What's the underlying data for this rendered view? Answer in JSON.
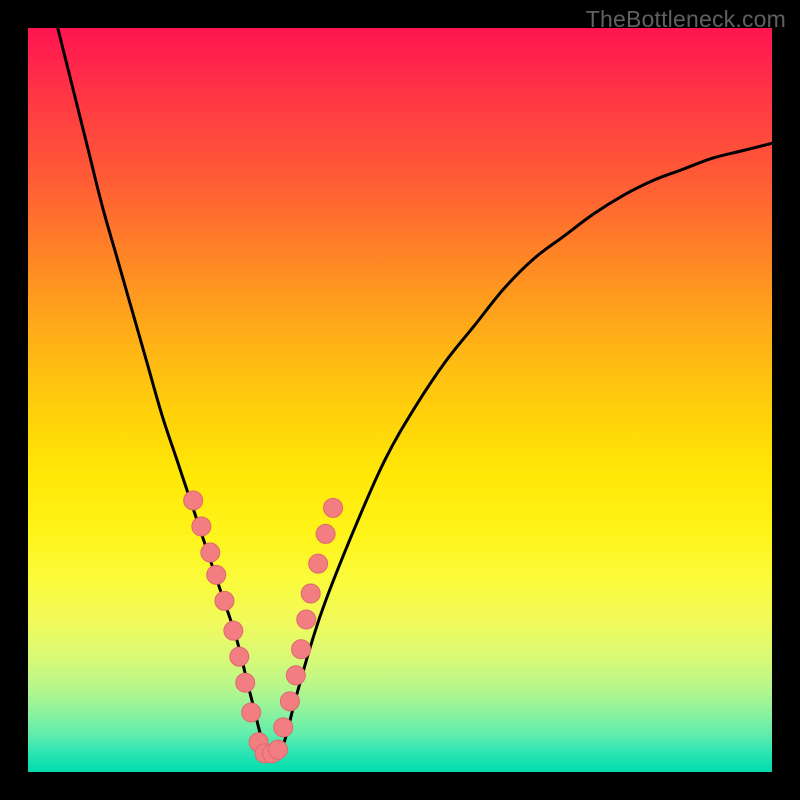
{
  "watermark": "TheBottleneck.com",
  "colors": {
    "curve": "#000000",
    "marker_fill": "#f27e82",
    "marker_stroke": "#de696d",
    "background_frame": "#000000"
  },
  "chart_data": {
    "type": "line",
    "title": "",
    "xlabel": "",
    "ylabel": "",
    "xlim": [
      0,
      100
    ],
    "ylim": [
      0,
      100
    ],
    "grid": false,
    "legend": false,
    "notes": "Rainbow gradient background (red top → green bottom) with a black V-shaped bottleneck curve. Minimum near x≈32. Salmon circular markers clustered on both flanks of the valley near the bottom.",
    "series": [
      {
        "name": "bottleneck-curve",
        "x": [
          4,
          6,
          8,
          10,
          12,
          14,
          16,
          18,
          20,
          22,
          24,
          26,
          28,
          30,
          32,
          34,
          36,
          38,
          40,
          44,
          48,
          52,
          56,
          60,
          64,
          68,
          72,
          76,
          80,
          84,
          88,
          92,
          96,
          100
        ],
        "y": [
          100,
          92,
          84,
          76,
          69,
          62,
          55,
          48,
          42,
          36,
          30,
          24,
          18,
          10,
          3,
          3,
          10,
          17,
          23,
          33,
          42,
          49,
          55,
          60,
          65,
          69,
          72,
          75,
          77.5,
          79.5,
          81,
          82.5,
          83.5,
          84.5
        ]
      },
      {
        "name": "markers-left",
        "x": [
          22.2,
          23.3,
          24.5,
          25.3,
          26.4,
          27.6,
          28.4,
          29.2,
          30.0,
          31.0
        ],
        "y": [
          36.5,
          33.0,
          29.5,
          26.5,
          23.0,
          19.0,
          15.5,
          12.0,
          8.0,
          4.0
        ]
      },
      {
        "name": "markers-right",
        "x": [
          34.3,
          35.2,
          36.0,
          36.7,
          37.4,
          38.0,
          39.0,
          40.0,
          41.0
        ],
        "y": [
          6.0,
          9.5,
          13.0,
          16.5,
          20.5,
          24.0,
          28.0,
          32.0,
          35.5
        ]
      },
      {
        "name": "markers-bottom",
        "x": [
          31.8,
          32.8,
          33.6
        ],
        "y": [
          2.5,
          2.5,
          3.0
        ]
      }
    ]
  }
}
